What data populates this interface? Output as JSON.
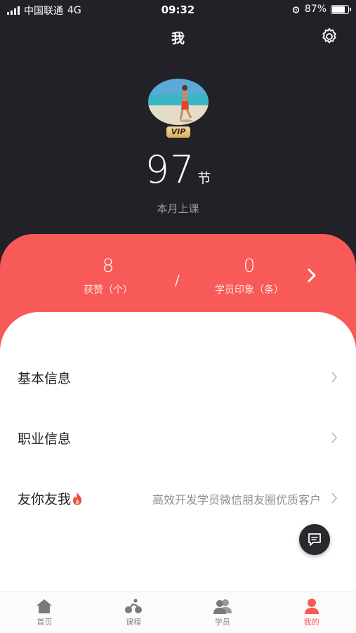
{
  "status_bar": {
    "carrier": "中国联通",
    "network": "4G",
    "time": "09:32",
    "battery": "87%"
  },
  "header": {
    "title": "我"
  },
  "profile": {
    "badge": "VIP",
    "count": "97",
    "count_unit": "节",
    "count_label": "本月上课"
  },
  "stats": [
    {
      "value": "8",
      "label": "获赞（个）"
    },
    {
      "value": "0",
      "label": "学员印象（条）"
    }
  ],
  "stats_separator": "/",
  "menu": [
    {
      "title": "基本信息",
      "subtitle": ""
    },
    {
      "title": "职业信息",
      "subtitle": ""
    },
    {
      "title": "友你友我",
      "subtitle": "高效开发学员微信朋友圈优质客户"
    }
  ],
  "tabs": [
    {
      "label": "首页",
      "icon": "home-icon",
      "active": false
    },
    {
      "label": "课程",
      "icon": "cycling-icon",
      "active": false
    },
    {
      "label": "学员",
      "icon": "users-icon",
      "active": false
    },
    {
      "label": "我的",
      "icon": "person-icon",
      "active": true
    }
  ],
  "colors": {
    "accent": "#f85a57",
    "dark_bg": "#222127"
  }
}
